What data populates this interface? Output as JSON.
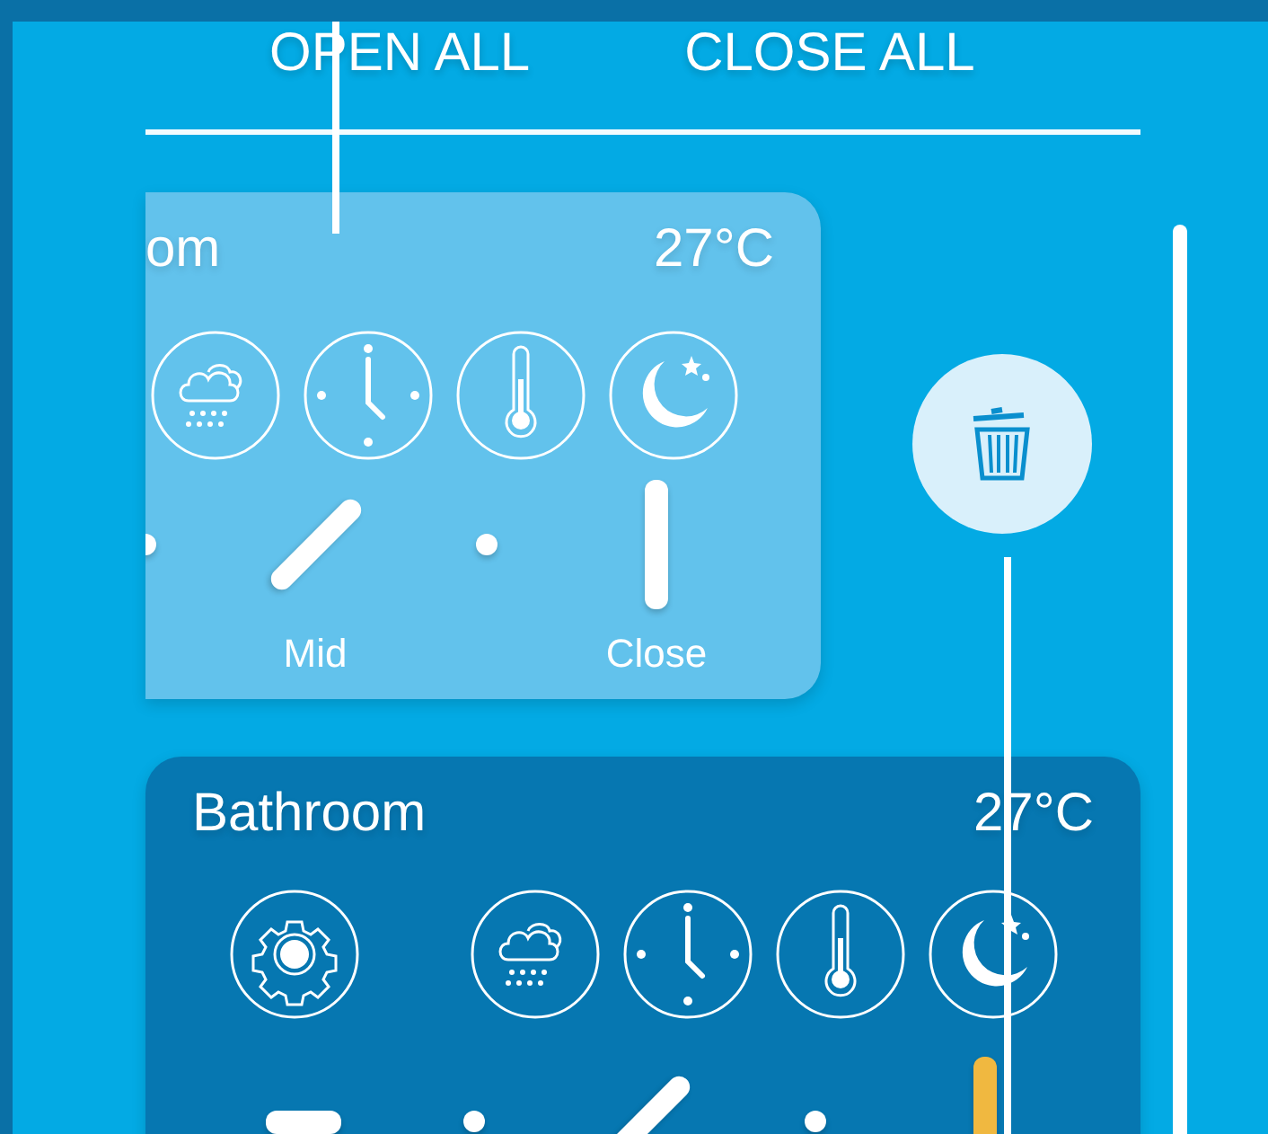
{
  "toolbar": {
    "buttons": [
      "OPEN ALL",
      "CLOSE ALL"
    ]
  },
  "cards": [
    {
      "title": "om",
      "temperature": "27°C",
      "swiped": true,
      "icons": [
        {
          "kind": "weather"
        },
        {
          "kind": "clock"
        },
        {
          "kind": "thermometer"
        },
        {
          "kind": "moon"
        }
      ],
      "positions": [
        {
          "kind": "step",
          "selected": false
        },
        {
          "kind": "mid",
          "label": "Mid",
          "selected": false
        },
        {
          "kind": "step",
          "selected": false
        },
        {
          "kind": "closed",
          "label": "Close",
          "selected": false
        }
      ]
    },
    {
      "title": "Bathroom",
      "temperature": "27°C",
      "swiped": false,
      "icons": [
        {
          "kind": "settings"
        },
        {
          "kind": "weather"
        },
        {
          "kind": "clock"
        },
        {
          "kind": "thermometer"
        },
        {
          "kind": "moon"
        }
      ],
      "positions": [
        {
          "kind": "open",
          "selected": false
        },
        {
          "kind": "step",
          "selected": false
        },
        {
          "kind": "mid",
          "selected": false
        },
        {
          "kind": "step",
          "selected": false
        },
        {
          "kind": "closed",
          "selected": true
        }
      ]
    }
  ]
}
